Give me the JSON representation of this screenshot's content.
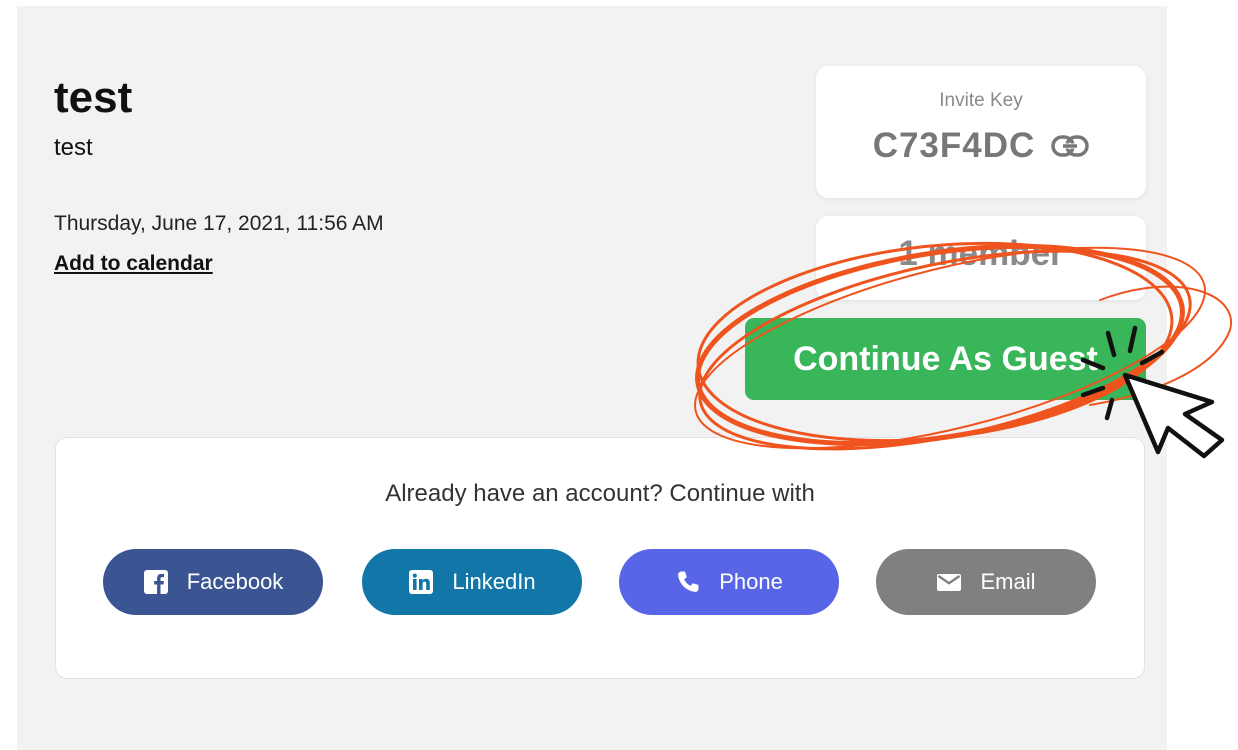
{
  "event": {
    "title": "test",
    "subtitle": "test",
    "datetime": "Thursday, June 17, 2021, 11:56 AM",
    "add_to_calendar": "Add to calendar"
  },
  "invite": {
    "label": "Invite Key",
    "key": "C73F4DC",
    "icon": "link-icon"
  },
  "members": {
    "text": "1 member"
  },
  "guest_button": {
    "label": "Continue As Guest",
    "color": "#39b55a"
  },
  "login": {
    "prompt": "Already have an account? Continue with",
    "providers": [
      {
        "label": "Facebook",
        "icon": "facebook-icon",
        "color": "#3b5593"
      },
      {
        "label": "LinkedIn",
        "icon": "linkedin-icon",
        "color": "#1376a8"
      },
      {
        "label": "Phone",
        "icon": "phone-icon",
        "color": "#5865e6"
      },
      {
        "label": "Email",
        "icon": "email-icon",
        "color": "#808080"
      }
    ]
  },
  "annotation": {
    "highlight_color": "#f0541e",
    "cursor_icon": "pointer-cursor-icon"
  }
}
